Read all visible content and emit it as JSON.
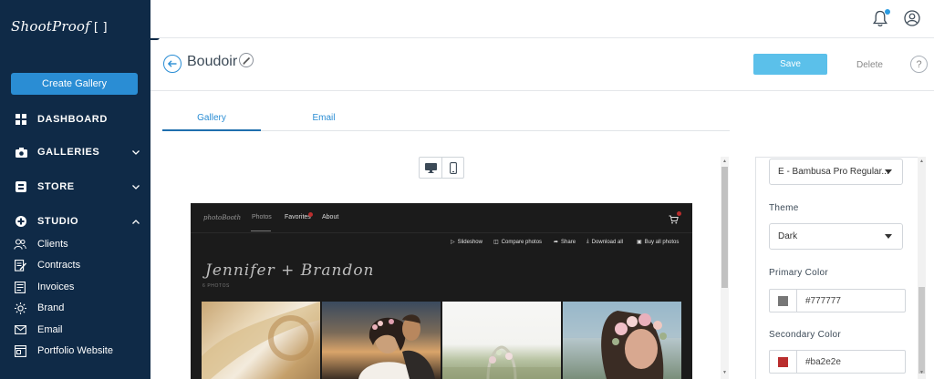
{
  "sidebar": {
    "logo_text": "ShootProof",
    "logo_mark": "[ ]",
    "create_label": "Create Gallery",
    "nav": [
      {
        "label": "DASHBOARD"
      },
      {
        "label": "GALLERIES"
      },
      {
        "label": "STORE"
      },
      {
        "label": "STUDIO"
      }
    ],
    "studio_items": [
      {
        "label": "Clients"
      },
      {
        "label": "Contracts"
      },
      {
        "label": "Invoices"
      },
      {
        "label": "Brand"
      },
      {
        "label": "Email"
      },
      {
        "label": "Portfolio Website"
      }
    ]
  },
  "header": {
    "title": "Boudoir",
    "save_label": "Save",
    "delete_label": "Delete",
    "help_label": "?"
  },
  "tabs": [
    {
      "label": "Gallery",
      "active": true
    },
    {
      "label": "Email",
      "active": false
    }
  ],
  "preview": {
    "brand": "photoBooth",
    "nav": [
      "Photos",
      "Favorites",
      "About"
    ],
    "actions": [
      "Slideshow",
      "Compare photos",
      "Share",
      "Download all",
      "Buy all photos"
    ],
    "title": "Jennifer + Brandon",
    "count": "6 PHOTOS"
  },
  "panel": {
    "font_value": "E - Bambusa Pro Regular...",
    "theme_label": "Theme",
    "theme_value": "Dark",
    "primary_label": "Primary Color",
    "primary_hex": "#777777",
    "secondary_label": "Secondary Color",
    "secondary_hex": "#ba2e2e"
  },
  "colors": {
    "sidebar_bg": "#0f2a47",
    "accent": "#2a8dd4",
    "save_bg": "#5bc0ea",
    "primary_swatch": "#777777",
    "secondary_swatch": "#ba2e2e"
  },
  "icons": {
    "notification": "bell-icon",
    "account": "user-icon",
    "back": "back-arrow-icon",
    "edit": "pencil-icon",
    "desktop": "desktop-icon",
    "mobile": "mobile-icon"
  }
}
